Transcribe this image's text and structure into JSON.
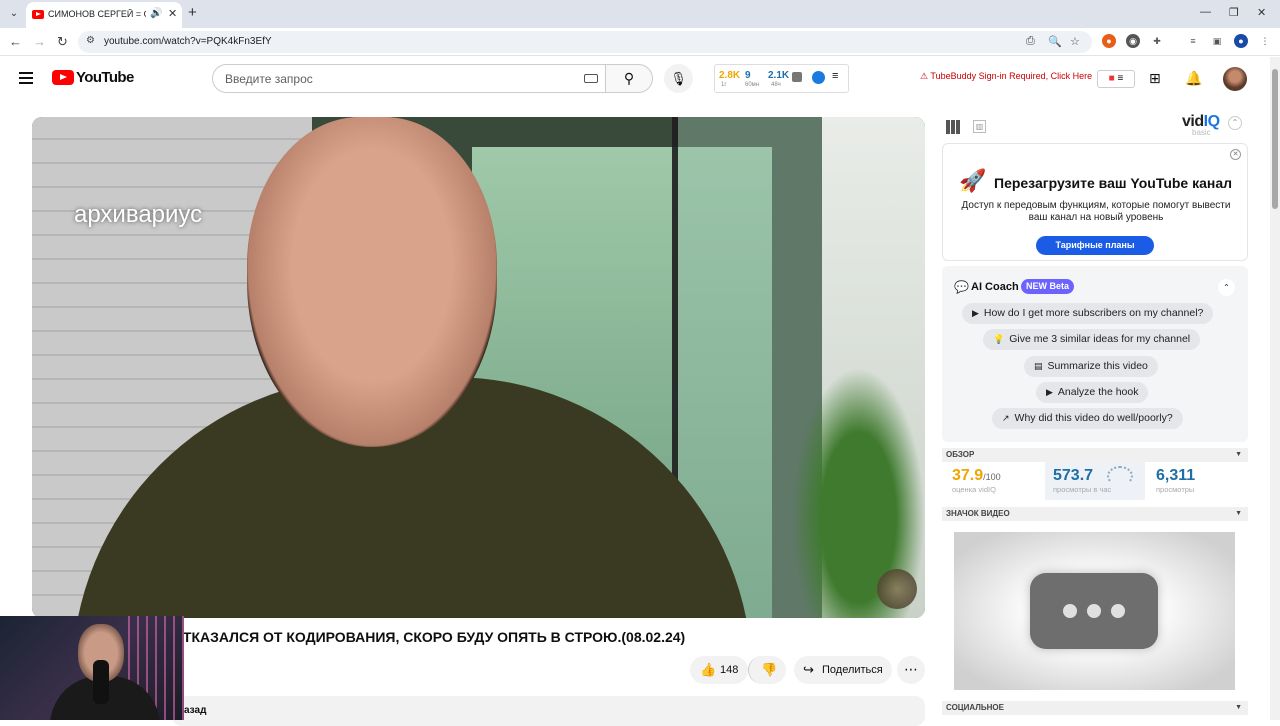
{
  "browser": {
    "tab_title": "СИМОНОВ СЕРГЕЙ = ОТК",
    "url": "youtube.com/watch?v=PQK4kFn3EfY"
  },
  "youtube": {
    "logo_text": "YouTube",
    "search_placeholder": "Введите запрос"
  },
  "vidiq_stats": {
    "v1": "2.8K",
    "v1_sub": "1г",
    "v2": "9",
    "v2_sub": "60мн",
    "v3": "2.1K",
    "v3_sub": "48ч"
  },
  "tubebuddy": {
    "warning": "TubeBuddy Sign-in Required, Click Here"
  },
  "video": {
    "watermark": "архивариус",
    "title": "ОТКАЗАЛСЯ ОТ КОДИРОВАНИЯ, СКОРО БУДУ ОПЯТЬ В СТРОЮ.(08.02.24)",
    "likes": "148",
    "share_label": "Поделиться",
    "desc_fragment": "азад"
  },
  "vidiq": {
    "logo_vid": "vid",
    "logo_iq": "IQ",
    "plan": "basic",
    "promo_title": "Перезагрузите ваш YouTube канал",
    "promo_text": "Доступ к передовым функциям, которые помогут вывести ваш канал на новый уровень",
    "promo_button": "Тарифные планы",
    "coach_title": "AI Coach",
    "coach_badge": "NEW Beta",
    "coach_questions": [
      "How do I get more subscribers on my channel?",
      "Give me 3 similar ideas for my channel",
      "Summarize this video",
      "Analyze the hook",
      "Why did this video do well/poorly?"
    ],
    "overview_label": "ОБЗОР",
    "score": "37.9",
    "score_max": "/100",
    "score_label": "оценка vidIQ",
    "views_per_hour": "573.7",
    "views_per_hour_label": "просмотры в час",
    "views": "6,311",
    "views_label": "просмотры",
    "thumb_label": "ЗНАЧОК ВИДЕО",
    "social_label": "СОЦИАЛЬНОЕ"
  },
  "colors": {
    "yt_red": "#ff0000",
    "vidiq_blue": "#1a5ce5",
    "score_orange": "#f0a500",
    "stat_blue": "#1e6ea8"
  }
}
